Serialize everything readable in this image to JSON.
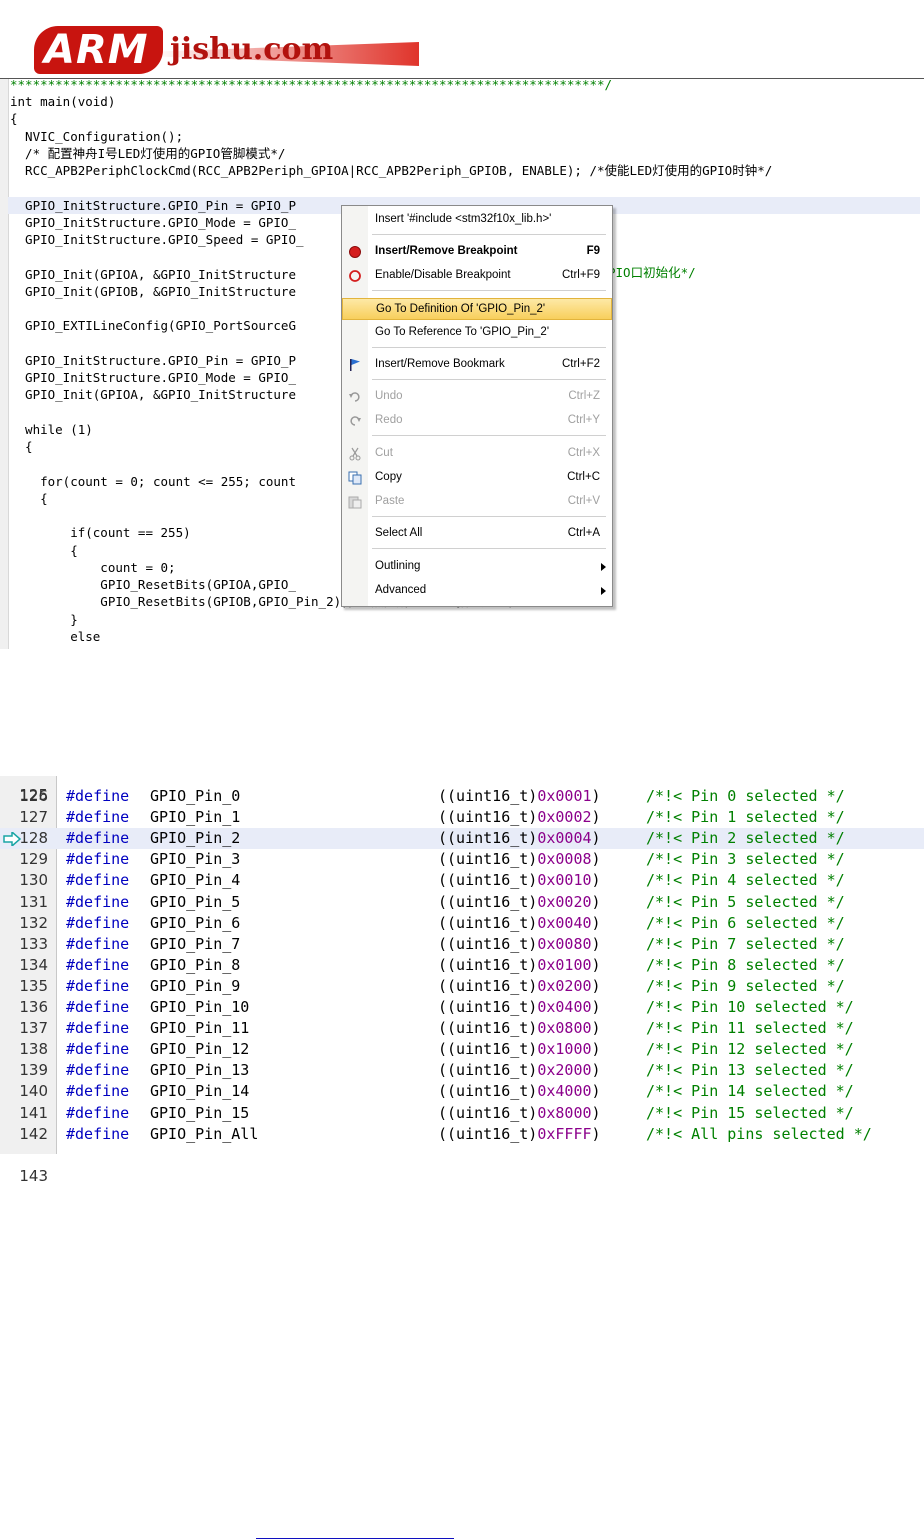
{
  "logo": {
    "brand": "ARM",
    "site": "jishu.com"
  },
  "editor1": {
    "star_line": "*******************************************************************************/",
    "lines": [
      {
        "text": "int main(void)"
      },
      {
        "text": "{"
      },
      {
        "text": "  NVIC_Configuration();"
      },
      {
        "text": "  /* 配置神舟I号LED灯使用的GPIO管脚模式*/"
      },
      {
        "text": "  RCC_APB2PeriphClockCmd(RCC_APB2Periph_GPIOA|RCC_APB2Periph_GPIOB, ENABLE); /*使能LED灯使用的GPIO时钟*/"
      },
      {
        "text": ""
      },
      {
        "text": "  GPIO_InitStructure.GPIO_Pin = GPIO_P"
      },
      {
        "text": "  GPIO_InitStructure.GPIO_Mode = GPIO_"
      },
      {
        "text": "  GPIO_InitStructure.GPIO_Speed = GPIO_"
      },
      {
        "text": ""
      },
      {
        "text": "  GPIO_Init(GPIOA, &GPIO_InitStructure"
      },
      {
        "text": "  GPIO_Init(GPIOB, &GPIO_InitStructure"
      },
      {
        "text": ""
      },
      {
        "text": "  GPIO_EXTILineConfig(GPIO_PortSourceG"
      },
      {
        "text": ""
      },
      {
        "text": "  GPIO_InitStructure.GPIO_Pin = GPIO_P"
      },
      {
        "text": "  GPIO_InitStructure.GPIO_Mode = GPIO_"
      },
      {
        "text": "  GPIO_Init(GPIOA, &GPIO_InitStructure"
      },
      {
        "text": ""
      },
      {
        "text": "  while (1)"
      },
      {
        "text": "  {"
      },
      {
        "text": ""
      },
      {
        "text": "    for(count = 0; count <= 255; count"
      },
      {
        "text": "    {"
      },
      {
        "text": ""
      },
      {
        "text": "        if(count == 255)"
      },
      {
        "text": "        {"
      },
      {
        "text": "            count = 0;"
      },
      {
        "text": "            GPIO_ResetBits(GPIOA,GPIO_"
      },
      {
        "text": "            GPIO_ResetBits(GPIOB,GPIO_Pin_2);/* 点亮所有的LED指示灯 */"
      },
      {
        "text": "        }"
      },
      {
        "text": "        else"
      }
    ],
    "partial_comment": "PIO口初始化*/"
  },
  "context_menu": {
    "items": [
      {
        "label": "Insert '#include <stm32f10x_lib.h>'",
        "shortcut": "",
        "icon": ""
      },
      {
        "label": "Insert/Remove Breakpoint",
        "shortcut": "F9",
        "icon": "breakpoint-icon"
      },
      {
        "label": "Enable/Disable Breakpoint",
        "shortcut": "Ctrl+F9",
        "icon": "breakpoint-toggle-icon"
      },
      {
        "label": "Go To Definition Of 'GPIO_Pin_2'",
        "shortcut": "",
        "icon": ""
      },
      {
        "label": "Go To Reference To 'GPIO_Pin_2'",
        "shortcut": "",
        "icon": ""
      },
      {
        "label": "Insert/Remove Bookmark",
        "shortcut": "Ctrl+F2",
        "icon": "bookmark-flag-icon"
      },
      {
        "label": "Undo",
        "shortcut": "Ctrl+Z",
        "icon": "undo-icon"
      },
      {
        "label": "Redo",
        "shortcut": "Ctrl+Y",
        "icon": "redo-icon"
      },
      {
        "label": "Cut",
        "shortcut": "Ctrl+X",
        "icon": "scissors-icon"
      },
      {
        "label": "Copy",
        "shortcut": "Ctrl+C",
        "icon": "copy-icon"
      },
      {
        "label": "Paste",
        "shortcut": "Ctrl+V",
        "icon": "paste-icon"
      },
      {
        "label": "Select All",
        "shortcut": "Ctrl+A",
        "icon": ""
      },
      {
        "label": "Outlining",
        "shortcut": "",
        "icon": ""
      },
      {
        "label": "Advanced",
        "shortcut": "",
        "icon": ""
      }
    ]
  },
  "editor2": {
    "top_partial_line": "125",
    "bottom_partial_line": "143",
    "rows": [
      {
        "line": "126",
        "kw": "#define",
        "name": "GPIO_Pin_0",
        "cast": "((uint16_t)",
        "hex": "0x0001",
        "close": ")",
        "comment": "/*!< Pin 0 selected */"
      },
      {
        "line": "127",
        "kw": "#define",
        "name": "GPIO_Pin_1",
        "cast": "((uint16_t)",
        "hex": "0x0002",
        "close": ")",
        "comment": "/*!< Pin 1 selected */"
      },
      {
        "line": "128",
        "kw": "#define",
        "name": "GPIO_Pin_2",
        "cast": "((uint16_t)",
        "hex": "0x0004",
        "close": ")",
        "comment": "/*!< Pin 2 selected */"
      },
      {
        "line": "129",
        "kw": "#define",
        "name": "GPIO_Pin_3",
        "cast": "((uint16_t)",
        "hex": "0x0008",
        "close": ")",
        "comment": "/*!< Pin 3 selected */"
      },
      {
        "line": "130",
        "kw": "#define",
        "name": "GPIO_Pin_4",
        "cast": "((uint16_t)",
        "hex": "0x0010",
        "close": ")",
        "comment": "/*!< Pin 4 selected */"
      },
      {
        "line": "131",
        "kw": "#define",
        "name": "GPIO_Pin_5",
        "cast": "((uint16_t)",
        "hex": "0x0020",
        "close": ")",
        "comment": "/*!< Pin 5 selected */"
      },
      {
        "line": "132",
        "kw": "#define",
        "name": "GPIO_Pin_6",
        "cast": "((uint16_t)",
        "hex": "0x0040",
        "close": ")",
        "comment": "/*!< Pin 6 selected */"
      },
      {
        "line": "133",
        "kw": "#define",
        "name": "GPIO_Pin_7",
        "cast": "((uint16_t)",
        "hex": "0x0080",
        "close": ")",
        "comment": "/*!< Pin 7 selected */"
      },
      {
        "line": "134",
        "kw": "#define",
        "name": "GPIO_Pin_8",
        "cast": "((uint16_t)",
        "hex": "0x0100",
        "close": ")",
        "comment": "/*!< Pin 8 selected */"
      },
      {
        "line": "135",
        "kw": "#define",
        "name": "GPIO_Pin_9",
        "cast": "((uint16_t)",
        "hex": "0x0200",
        "close": ")",
        "comment": "/*!< Pin 9 selected */"
      },
      {
        "line": "136",
        "kw": "#define",
        "name": "GPIO_Pin_10",
        "cast": "((uint16_t)",
        "hex": "0x0400",
        "close": ")",
        "comment": "/*!< Pin 10 selected */"
      },
      {
        "line": "137",
        "kw": "#define",
        "name": "GPIO_Pin_11",
        "cast": "((uint16_t)",
        "hex": "0x0800",
        "close": ")",
        "comment": "/*!< Pin 11 selected */"
      },
      {
        "line": "138",
        "kw": "#define",
        "name": "GPIO_Pin_12",
        "cast": "((uint16_t)",
        "hex": "0x1000",
        "close": ")",
        "comment": "/*!< Pin 12 selected */"
      },
      {
        "line": "139",
        "kw": "#define",
        "name": "GPIO_Pin_13",
        "cast": "((uint16_t)",
        "hex": "0x2000",
        "close": ")",
        "comment": "/*!< Pin 13 selected */"
      },
      {
        "line": "140",
        "kw": "#define",
        "name": "GPIO_Pin_14",
        "cast": "((uint16_t)",
        "hex": "0x4000",
        "close": ")",
        "comment": "/*!< Pin 14 selected */"
      },
      {
        "line": "141",
        "kw": "#define",
        "name": "GPIO_Pin_15",
        "cast": "((uint16_t)",
        "hex": "0x8000",
        "close": ")",
        "comment": "/*!< Pin 15 selected */"
      },
      {
        "line": "142",
        "kw": "#define",
        "name": "GPIO_Pin_All",
        "cast": "((uint16_t)",
        "hex": "0xFFFF",
        "close": ")",
        "comment": "/*!< All pins selected */"
      }
    ]
  },
  "colors": {
    "highlight": "#e8ecf8",
    "menu_active": "#f8cf5c",
    "keyword_blue": "#0000c0",
    "comment_green": "#008000",
    "number_purple": "#8b008b"
  }
}
